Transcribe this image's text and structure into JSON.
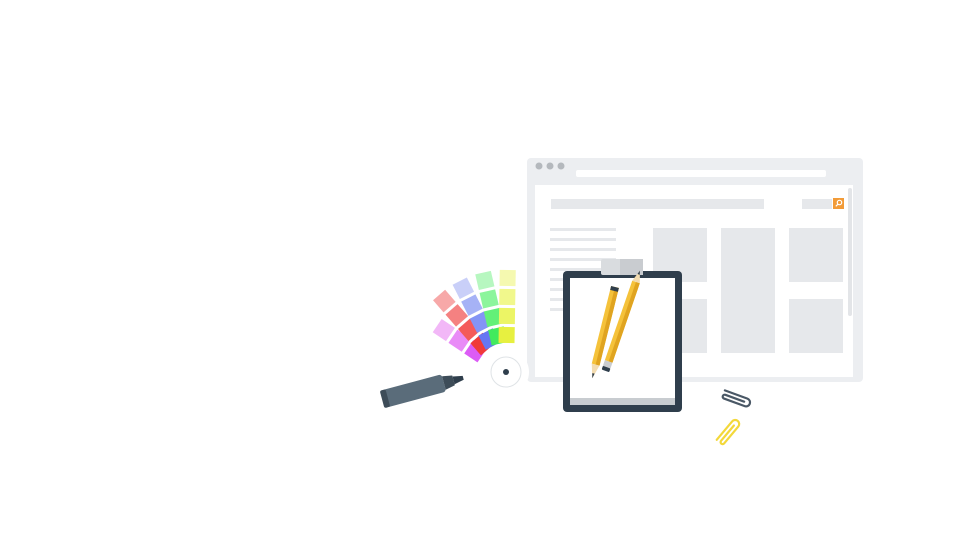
{
  "scene": {
    "browser_mock": {
      "window_dots": 3,
      "search_icon": "search-icon",
      "accent": "#f29b38",
      "sidebar_line_count": 9,
      "content_blocks": 5
    },
    "color_fan": {
      "columns": [
        [
          "#f2b7f7",
          "#e98bf7",
          "#dc5cf6"
        ],
        [
          "#f7a8a8",
          "#f58181",
          "#f45a5a",
          "#f03a3a"
        ],
        [
          "#c9cff8",
          "#a6b2f6",
          "#8494f5",
          "#6676f2"
        ],
        [
          "#b7f7c0",
          "#8cf59c",
          "#63f078",
          "#42ea5d"
        ],
        [
          "#f5f9b0",
          "#f1f88c",
          "#ecf565",
          "#e7f040"
        ]
      ]
    },
    "clipboard": {
      "pencil_color": "#f5c23a",
      "pencil_shade": "#e0a420",
      "frame_color": "#2f3e4c"
    },
    "marker": {
      "body_color": "#5a6c7a",
      "cap_color": "#3d4c58"
    },
    "paperclips": [
      {
        "color": "#4a5866"
      },
      {
        "color": "#f3d83a"
      }
    ]
  }
}
